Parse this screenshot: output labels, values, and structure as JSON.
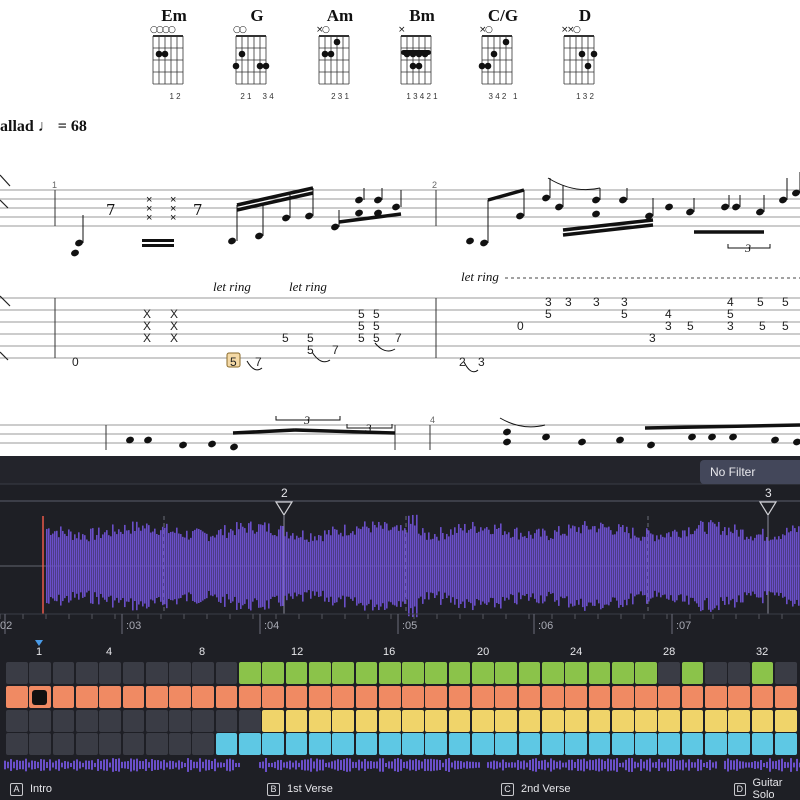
{
  "chords": [
    {
      "name": "Em",
      "fingers": "1 2"
    },
    {
      "name": "G",
      "fingers": "2 1     3 4"
    },
    {
      "name": "Am",
      "fingers": "2 3 1"
    },
    {
      "name": "Bm",
      "fingers": "1 3 4 2 1"
    },
    {
      "name": "C/G",
      "fingers": "3 4 2   1"
    },
    {
      "name": "D",
      "fingers": "1 3 2"
    }
  ],
  "tempo": {
    "style_text": "allad",
    "bpm_text": "= 68"
  },
  "let_ring": [
    "let ring",
    "let ring",
    "let ring"
  ],
  "measure_numbers": [
    "1",
    "2",
    "4"
  ],
  "tuplets": [
    "3",
    "3",
    "3"
  ],
  "tab": {
    "m1": [
      "X",
      "X",
      "X",
      "X",
      "X",
      "X",
      "0",
      "5",
      "7",
      "5",
      "5",
      "5",
      "7",
      "5",
      "5",
      "5",
      "5",
      "5",
      "5",
      "7"
    ],
    "m2": [
      "2",
      "3",
      "0",
      "3",
      "3",
      "5",
      "3",
      "3",
      "5",
      "3",
      "3",
      "4",
      "5",
      "5",
      "3",
      "5",
      "5",
      "4",
      "5",
      "5"
    ]
  },
  "filter": {
    "label": "No Filter"
  },
  "markers": [
    "2",
    "3"
  ],
  "timeline": [
    ":02",
    ":03",
    ":04",
    ":05",
    ":06",
    ":07"
  ],
  "bars": [
    "1",
    "4",
    "8",
    "12",
    "16",
    "20",
    "24",
    "28",
    "32"
  ],
  "sections": [
    {
      "key": "A",
      "label": "Intro"
    },
    {
      "key": "B",
      "label": "1st Verse"
    },
    {
      "key": "C",
      "label": "2nd Verse"
    },
    {
      "key": "D",
      "label": "Guitar Solo"
    }
  ],
  "colors": {
    "green": "#8bc34a",
    "orange": "#f08a63",
    "yellow": "#f0d46a",
    "cyan": "#5ec8e4",
    "waveform": "#6a4fc9",
    "dark_cell": "#3a3c45"
  }
}
